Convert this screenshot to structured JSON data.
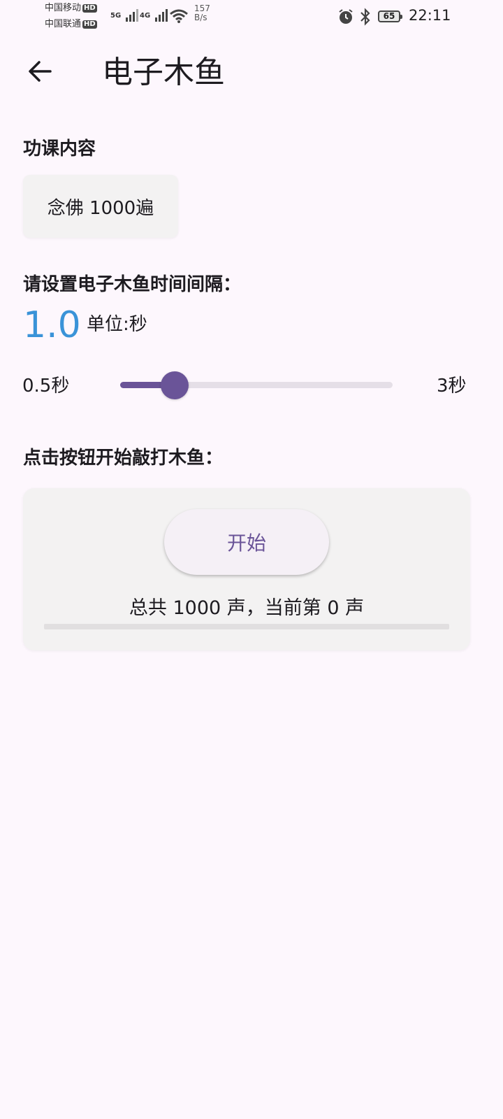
{
  "status_bar": {
    "carrier1": "中国移动",
    "carrier2": "中国联通",
    "hd": "HD",
    "net1": "5G",
    "net2": "4G",
    "speed_value": "157",
    "speed_unit": "B/s",
    "battery": "65",
    "time": "22:11"
  },
  "app_bar": {
    "title": "电子木鱼"
  },
  "lesson": {
    "label": "功课内容",
    "value": "念佛 1000遍"
  },
  "interval": {
    "label": "请设置电子木鱼时间间隔：",
    "value": "1.0",
    "unit": "单位:秒",
    "min_label": "0.5秒",
    "max_label": "3秒",
    "min": 0.5,
    "max": 3,
    "current": 1.0
  },
  "action": {
    "label": "点击按钮开始敲打木鱼：",
    "start_button": "开始",
    "count_text": "总共 1000 声，当前第 0 声",
    "total": 1000,
    "current": 0
  },
  "colors": {
    "accent": "#6a5498",
    "value": "#3a93d8",
    "background": "#fdf7fd"
  }
}
